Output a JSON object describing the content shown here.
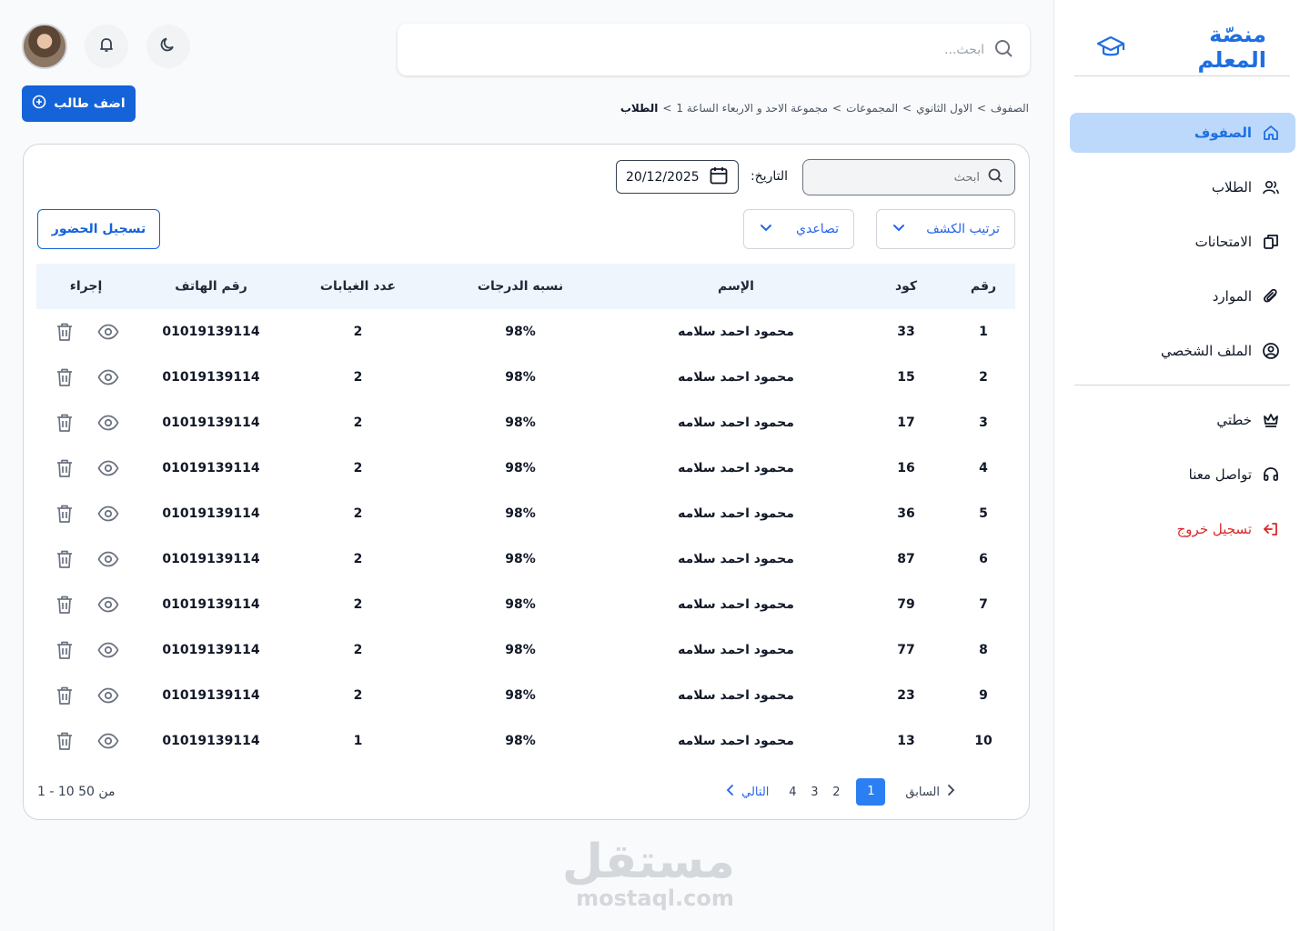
{
  "sidebar": {
    "brand": "منصّة المعلم",
    "items": [
      {
        "label": "الصفوف",
        "icon": "home-icon",
        "active": true
      },
      {
        "label": "الطلاب",
        "icon": "users-icon"
      },
      {
        "label": "الامتحانات",
        "icon": "copy-icon"
      },
      {
        "label": "الموارد",
        "icon": "paperclip-icon"
      },
      {
        "label": "الملف الشخصي",
        "icon": "user-circle-icon"
      }
    ],
    "secondary": [
      {
        "label": "خطتي",
        "icon": "crown-icon"
      },
      {
        "label": "تواصل معنا",
        "icon": "headset-icon"
      },
      {
        "label": "تسجيل خروج",
        "icon": "logout-icon"
      }
    ]
  },
  "topbar": {
    "search_placeholder": "ابحث..."
  },
  "actions": {
    "add_student": "اضف طالب"
  },
  "breadcrumb": {
    "items": [
      "الصفوف",
      "الاول الثانوي",
      "المجموعات",
      "مجموعة الاحد و الاربعاء الساعة 1"
    ],
    "current": "الطلاب",
    "separator": ">"
  },
  "filters": {
    "search_placeholder": "ابحث",
    "date_label": "التاريخ:",
    "date_value": "20/12/2025",
    "sort_label": "ترتيب الكشف",
    "order_label": "تصاعدي",
    "attendance_button": "تسجيل الحضور"
  },
  "table": {
    "headers": [
      "رقم",
      "كود",
      "الإسم",
      "نسبه الدرجات",
      "عدد الغيابات",
      "رقم الهاتف",
      "إجراء"
    ],
    "rows": [
      {
        "num": "1",
        "code": "33",
        "name": "محمود احمد  سلامه",
        "grade": "98%",
        "absences": "2",
        "phone": "01019139114"
      },
      {
        "num": "2",
        "code": "15",
        "name": "محمود احمد  سلامه",
        "grade": "98%",
        "absences": "2",
        "phone": "01019139114"
      },
      {
        "num": "3",
        "code": "17",
        "name": "محمود احمد  سلامه",
        "grade": "98%",
        "absences": "2",
        "phone": "01019139114"
      },
      {
        "num": "4",
        "code": "16",
        "name": "محمود احمد  سلامه",
        "grade": "98%",
        "absences": "2",
        "phone": "01019139114"
      },
      {
        "num": "5",
        "code": "36",
        "name": "محمود احمد  سلامه",
        "grade": "98%",
        "absences": "2",
        "phone": "01019139114"
      },
      {
        "num": "6",
        "code": "87",
        "name": "محمود احمد  سلامه",
        "grade": "98%",
        "absences": "2",
        "phone": "01019139114"
      },
      {
        "num": "7",
        "code": "79",
        "name": "محمود احمد  سلامه",
        "grade": "98%",
        "absences": "2",
        "phone": "01019139114"
      },
      {
        "num": "8",
        "code": "77",
        "name": "محمود احمد  سلامه",
        "grade": "98%",
        "absences": "2",
        "phone": "01019139114"
      },
      {
        "num": "9",
        "code": "23",
        "name": "محمود احمد  سلامه",
        "grade": "98%",
        "absences": "2",
        "phone": "01019139114"
      },
      {
        "num": "10",
        "code": "13",
        "name": "محمود احمد  سلامه",
        "grade": "98%",
        "absences": "1",
        "phone": "01019139114"
      }
    ]
  },
  "pagination": {
    "prev": "السابق",
    "next": "التالي",
    "pages": [
      "1",
      "2",
      "3",
      "4"
    ],
    "current": "1",
    "range": "1 - 10 من  50"
  },
  "watermark": {
    "arabic": "مستقل",
    "latin": "mostaql.com"
  },
  "colors": {
    "primary": "#1463d8",
    "active_nav_bg": "#bcd9fb",
    "logout": "#dc2626",
    "table_header_bg": "#eef5fd"
  }
}
